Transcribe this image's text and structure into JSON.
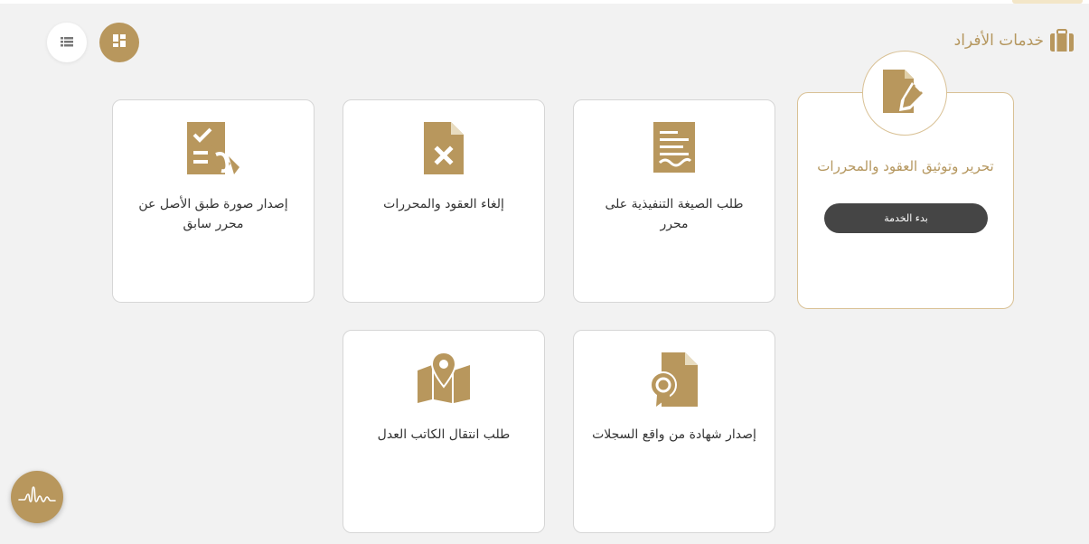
{
  "section": {
    "title": "خدمات الأفراد",
    "icon": "briefcase-icon"
  },
  "view_toggle": {
    "grid_icon": "grid-view-icon",
    "list_icon": "list-view-icon"
  },
  "featured": {
    "title": "تحرير وتوثيق العقود والمحررات",
    "button_label": "بدء الخدمة",
    "icon": "edit-document-icon"
  },
  "services": [
    {
      "label": "طلب الصيغة التنفيذية على محرر",
      "icon": "document-lines-icon"
    },
    {
      "label": "إلغاء العقود والمحررات",
      "icon": "cancel-document-icon"
    },
    {
      "label": "إصدار صورة طبق الأصل عن محرر سابق",
      "icon": "certified-copy-icon"
    },
    {
      "label": "إصدار شهادة من واقع السجلات",
      "icon": "certificate-icon"
    },
    {
      "label": "طلب انتقال الكاتب العدل",
      "icon": "map-location-icon"
    }
  ],
  "assistant": {
    "icon": "signature-logo-icon"
  },
  "colors": {
    "accent": "#b8975d",
    "button_dark": "#454545",
    "background": "#f2f2f2"
  }
}
